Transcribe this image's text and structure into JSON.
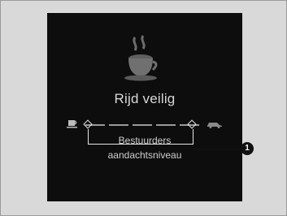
{
  "screen": {
    "title": "Rijd veilig",
    "level_label_line1": "Bestuurders",
    "level_label_line2": "aandachtsniveau",
    "main_icon": "coffee-cup-icon",
    "left_icon": "coffee-cup-icon",
    "right_icon": "car-icon",
    "level_segments": 5
  },
  "callout": {
    "number": "1"
  },
  "colors": {
    "screen_bg": "#0d0d0d",
    "frame_bg": "#d9d9d9",
    "text": "#d8d8d8"
  }
}
